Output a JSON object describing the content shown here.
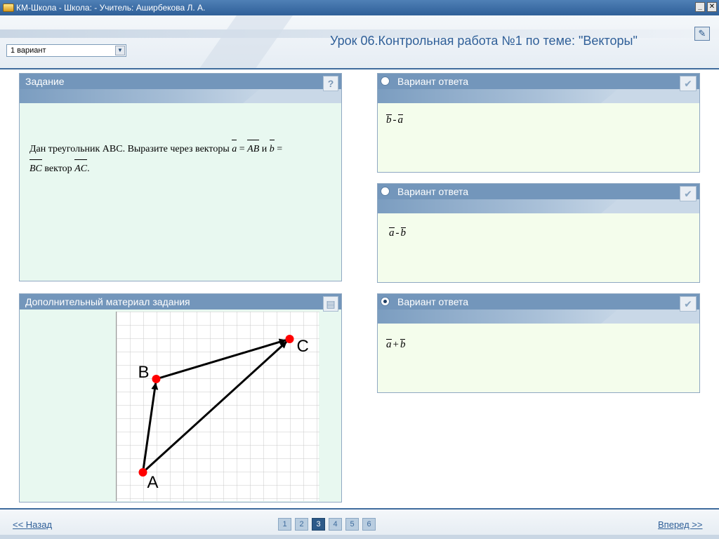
{
  "window": {
    "title": "КМ-Школа - Школа:  - Учитель: Аширбекова Л. А."
  },
  "header": {
    "variant_selected": "1 вариант",
    "lesson_title": "Урок 06.Контрольная работа №1 по теме: \"Векторы\""
  },
  "task": {
    "heading": "Задание",
    "help_icon": "question-icon",
    "text_prefix": "Дан треугольник ABC. Выразите через векторы",
    "vec_a": "a",
    "eq1": "=",
    "vec_AB": "AB",
    "conj": "и",
    "vec_b": "b",
    "eq2": "=",
    "vec_BC": "BC",
    "word_vector": "вектор",
    "vec_AC": "AC",
    "end": "."
  },
  "extra": {
    "heading": "Дополнительный материал задания",
    "icon": "document-icon",
    "points": [
      {
        "label": "A",
        "x": 2,
        "y": 2
      },
      {
        "label": "B",
        "x": 3,
        "y": 9
      },
      {
        "label": "C",
        "x": 13,
        "y": 12
      }
    ]
  },
  "answers": [
    {
      "heading": "Вариант ответа",
      "left": "b",
      "op": "-",
      "right": "a",
      "selected": false
    },
    {
      "heading": "Вариант ответа",
      "left": "a",
      "op": "-",
      "right": "b",
      "selected": false
    },
    {
      "heading": "Вариант ответа",
      "left": "a",
      "op": "+",
      "right": "b",
      "selected": true
    }
  ],
  "footer": {
    "back": "<< Назад",
    "forward": "Вперед >>",
    "pages": [
      "1",
      "2",
      "3",
      "4",
      "5",
      "6"
    ],
    "current_page": "3"
  },
  "colors": {
    "accent": "#2f5f98",
    "panel_head": "#7396bb",
    "point": "#ff0000"
  }
}
